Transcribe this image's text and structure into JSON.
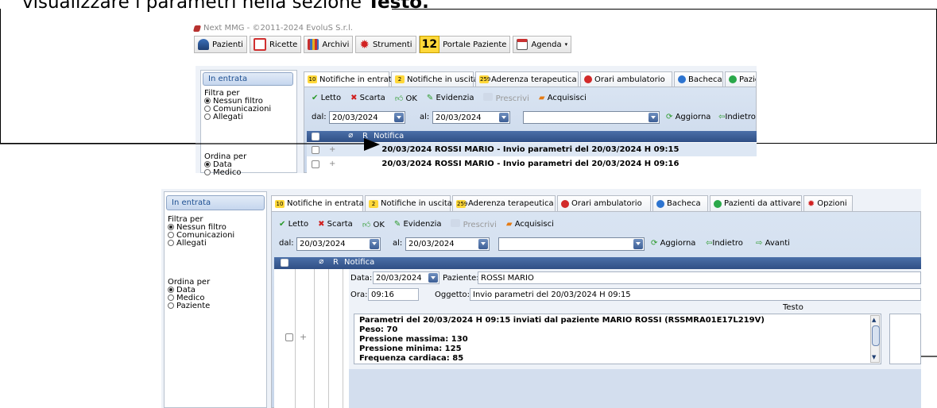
{
  "heading": {
    "prefix": "visualizzare i parametri nella sezione ",
    "bold": "Testo."
  },
  "app": {
    "title": "Next MMG - ©2011-2024 EvoluS S.r.l.",
    "toolbar": {
      "pazienti": "Pazienti",
      "ricette": "Ricette",
      "archivi": "Archivi",
      "strumenti": "Strumenti",
      "portale_count": "12",
      "portale": "Portale Paziente",
      "agenda": "Agenda"
    }
  },
  "left": {
    "inentrata": "In entrata",
    "filtra": "Filtra per",
    "nessun": "Nessun filtro",
    "comunicazioni": "Comunicazioni",
    "allegati": "Allegati",
    "ordina": "Ordina per",
    "data": "Data",
    "medico": "Medico",
    "paziente": "Paziente",
    "medico_cut": "Medico"
  },
  "tabs": [
    {
      "badge": "10",
      "label": "Notifiche in entrata"
    },
    {
      "badge": "2",
      "label": "Notifiche in uscita"
    },
    {
      "badge": "259",
      "label": "Aderenza terapeutica"
    },
    {
      "badge": "",
      "label": "Orari ambulatorio"
    },
    {
      "badge": "",
      "label": "Bacheca"
    },
    {
      "badge": "",
      "label": "Pazienti da attivare"
    },
    {
      "badge": "",
      "label": "Opzioni"
    }
  ],
  "actions": {
    "letto": "Letto",
    "scarta": "Scarta",
    "ok": "OK",
    "evidenzia": "Evidenzia",
    "prescrivi": "Prescrivi",
    "acquisisci": "Acquisisci",
    "dal": "dal:",
    "al": "al:",
    "dal_value": "20/03/2024",
    "al_value": "20/03/2024",
    "aggiorna": "Aggiorna",
    "indietro": "Indietro",
    "avanti": "Avanti"
  },
  "grid": {
    "col_r": "R",
    "col_notifica": "Notifica",
    "rows": [
      "20/03/2024  ROSSI MARIO  -  Invio parametri del 20/03/2024 H 09:15",
      "20/03/2024  ROSSI MARIO  -  Invio parametri del 20/03/2024 H 09:16"
    ],
    "plus": "+"
  },
  "detail": {
    "data_label": "Data:",
    "data_value": "20/03/2024",
    "paziente_label": "Paziente:",
    "paziente_value": "ROSSI MARIO",
    "ora_label": "Ora:",
    "ora_value": "09:16",
    "oggetto_label": "Oggetto:",
    "oggetto_value": "Invio parametri del 20/03/2024 H 09:15",
    "testo_label": "Testo",
    "testo_lines": [
      "Parametri del 20/03/2024 H 09:15 inviati dal paziente MARIO ROSSI (RSSMRA01E17L219V)",
      "Peso: 70",
      "Pressione massima: 130",
      "Pressione minima: 125",
      "Frequenza cardiaca: 85"
    ]
  },
  "colors": {
    "accent_blue": "#2f4f85",
    "panel_blue": "#d0dcee",
    "badge_yellow": "#ffd83a"
  }
}
